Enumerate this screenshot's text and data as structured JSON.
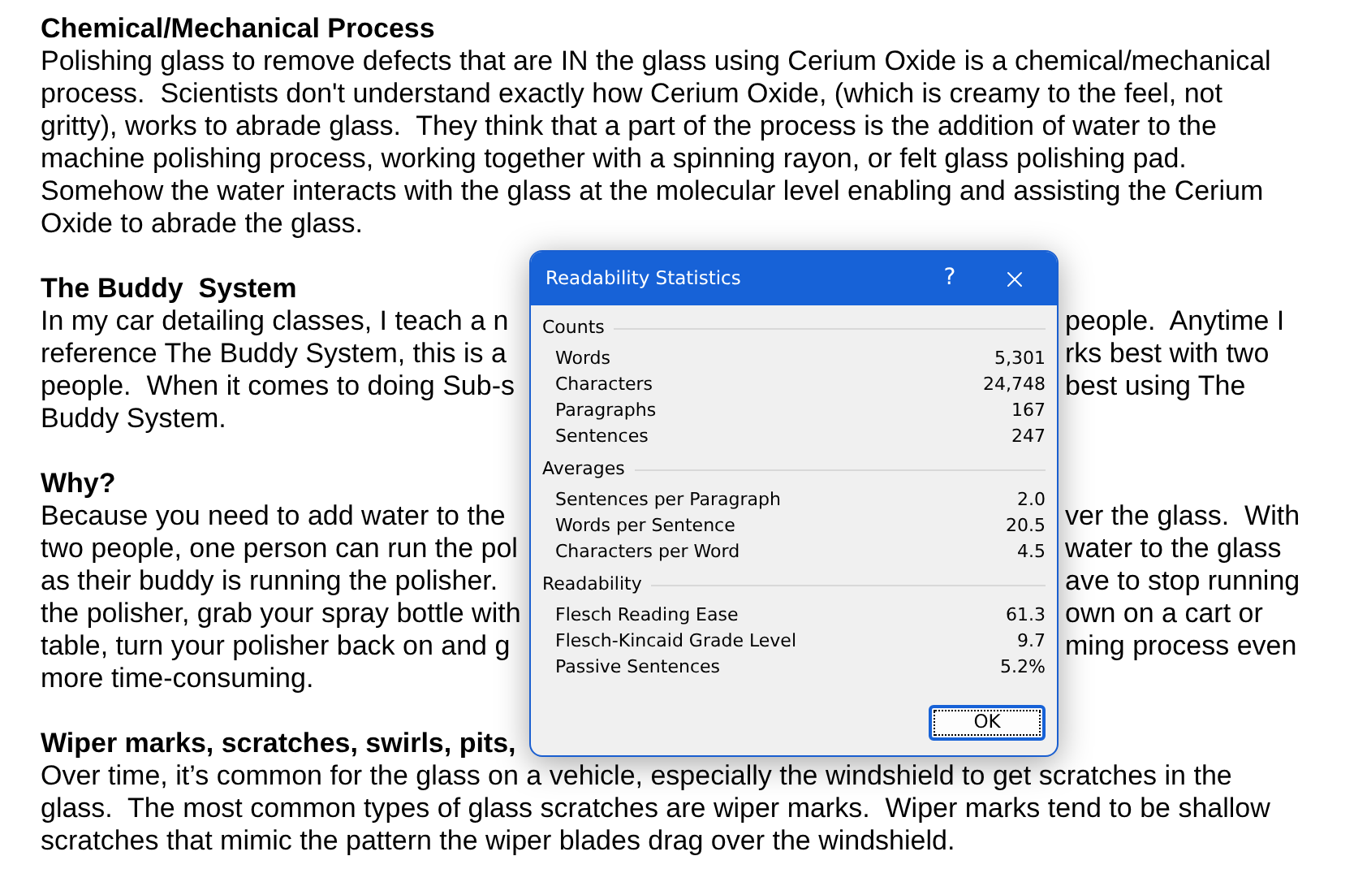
{
  "document": {
    "blocks": [
      {
        "kind": "heading",
        "lines": [
          {
            "left": "Chemical/Mechanical Process"
          }
        ]
      },
      {
        "kind": "paragraph",
        "lines": [
          {
            "left": "Polishing glass to remove defects that are IN the glass using Cerium Oxide is a chemical/mechanical"
          },
          {
            "left": "process.  Scientists don't understand exactly how Cerium Oxide, (which is creamy to the feel, not"
          },
          {
            "left": "gritty), works to abrade glass.  They think that a part of the process is the addition of water to the"
          },
          {
            "left": "machine polishing process, working together with a spinning rayon, or felt glass polishing pad."
          },
          {
            "left": "Somehow the water interacts with the glass at the molecular level enabling and assisting the Cerium"
          },
          {
            "left": "Oxide to abrade the glass."
          }
        ]
      },
      {
        "kind": "heading",
        "lines": [
          {
            "left": "The Buddy  System"
          }
        ]
      },
      {
        "kind": "paragraph",
        "lines": [
          {
            "left": "In my car detailing classes, I teach a n",
            "right": "people.  Anytime I"
          },
          {
            "left": "reference The Buddy System, this is a",
            "right": "rks best with two"
          },
          {
            "left": "people.  When it comes to doing Sub-s",
            "right": "best using The"
          },
          {
            "left": "Buddy System."
          }
        ]
      },
      {
        "kind": "heading",
        "lines": [
          {
            "left": "Why?"
          }
        ]
      },
      {
        "kind": "paragraph",
        "lines": [
          {
            "left": "Because you need to add water to the",
            "right": "ver the glass.  With"
          },
          {
            "left": "two people, one person can run the pol",
            "right": "water to the glass"
          },
          {
            "left": "as their buddy is running the polisher.",
            "right": "ave to stop running"
          },
          {
            "left": "the polisher, grab your spray bottle with",
            "right": "own on a cart or"
          },
          {
            "left": "table, turn your polisher back on and g",
            "right": "ming process even"
          },
          {
            "left": "more time-consuming."
          }
        ]
      },
      {
        "kind": "heading",
        "lines": [
          {
            "left": "Wiper marks, scratches, swirls, pits,"
          }
        ]
      },
      {
        "kind": "paragraph",
        "lines": [
          {
            "left": "Over time, it’s common for the glass on a vehicle, especially the windshield to get scratches in the"
          },
          {
            "left": "glass.  The most common types of glass scratches are wiper marks.  Wiper marks tend to be shallow"
          },
          {
            "left": "scratches that mimic the pattern the wiper blades drag over the windshield."
          }
        ]
      }
    ]
  },
  "dialog": {
    "title": "Readability Statistics",
    "help_button": "?",
    "sections": [
      {
        "label": "Counts",
        "rows": [
          {
            "label": "Words",
            "value": "5,301"
          },
          {
            "label": "Characters",
            "value": "24,748"
          },
          {
            "label": "Paragraphs",
            "value": "167"
          },
          {
            "label": "Sentences",
            "value": "247"
          }
        ]
      },
      {
        "label": "Averages",
        "rows": [
          {
            "label": "Sentences per Paragraph",
            "value": "2.0"
          },
          {
            "label": "Words per Sentence",
            "value": "20.5"
          },
          {
            "label": "Characters per Word",
            "value": "4.5"
          }
        ]
      },
      {
        "label": "Readability",
        "rows": [
          {
            "label": "Flesch Reading Ease",
            "value": "61.3"
          },
          {
            "label": "Flesch-Kincaid Grade Level",
            "value": "9.7"
          },
          {
            "label": "Passive Sentences",
            "value": "5.2%"
          }
        ]
      }
    ],
    "ok_button": "OK"
  }
}
